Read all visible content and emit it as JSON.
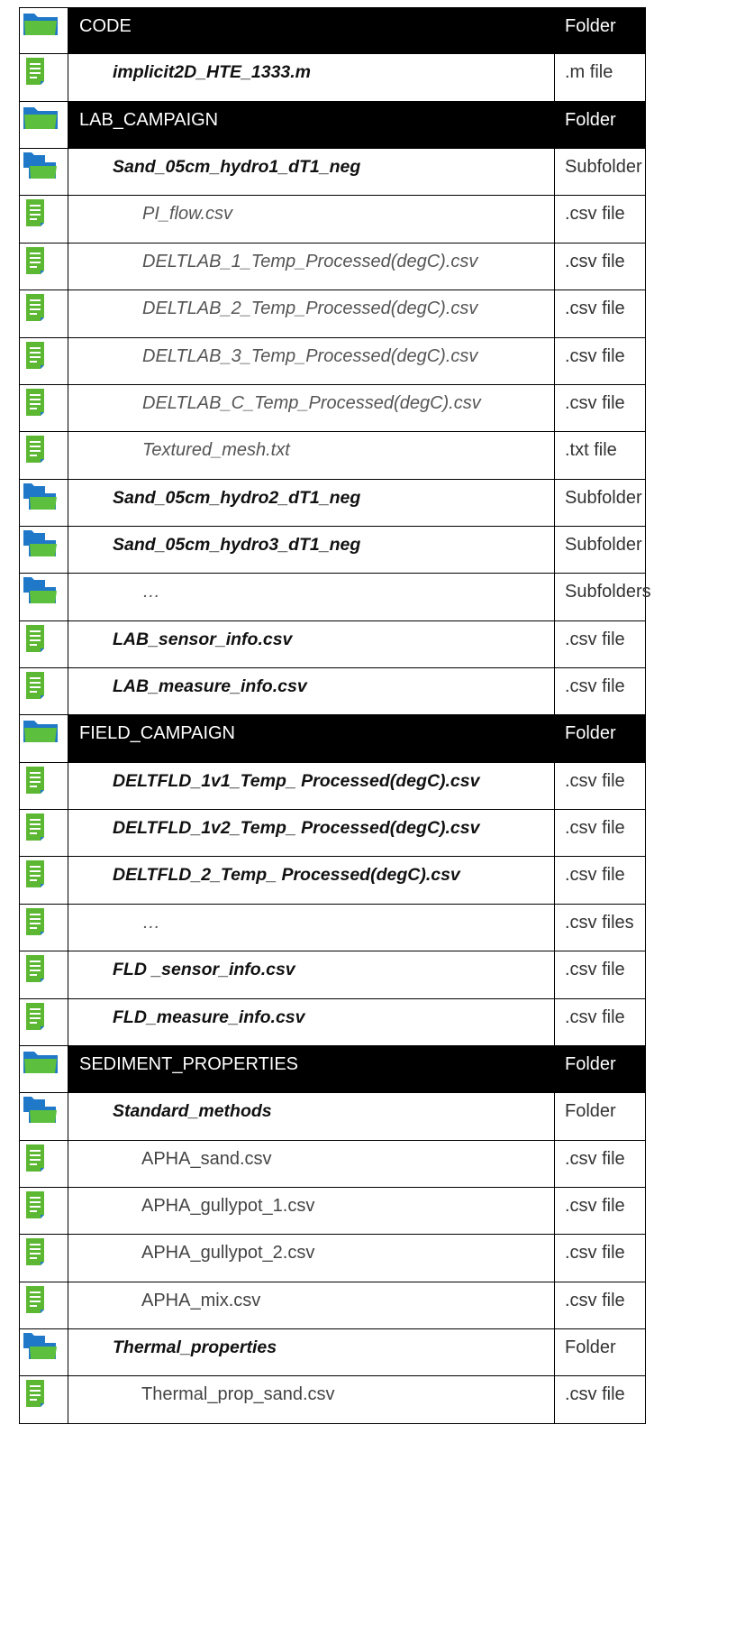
{
  "rows": [
    {
      "kind": "folder",
      "icon": "folder-icon",
      "name": "CODE",
      "type": "Folder"
    },
    {
      "kind": "file",
      "level": 1,
      "icon": "document-icon",
      "name": "implicit2D_HTE_1333.m",
      "type": ".m file"
    },
    {
      "kind": "folder",
      "icon": "folder-icon",
      "name": "LAB_CAMPAIGN",
      "type": "Folder"
    },
    {
      "kind": "subfolder",
      "level": 1,
      "icon": "subfolder-icon",
      "name": "Sand_05cm_hydro1_dT1_neg",
      "type": "Subfolder"
    },
    {
      "kind": "file",
      "level": 2,
      "icon": "document-icon",
      "name": "PI_flow.csv",
      "type": ".csv file"
    },
    {
      "kind": "file",
      "level": 2,
      "icon": "document-icon",
      "name": "DELTLAB_1_Temp_Processed(degC).csv",
      "type": ".csv file"
    },
    {
      "kind": "file",
      "level": 2,
      "icon": "document-icon",
      "name": "DELTLAB_2_Temp_Processed(degC).csv",
      "type": ".csv file"
    },
    {
      "kind": "file",
      "level": 2,
      "icon": "document-icon",
      "name": "DELTLAB_3_Temp_Processed(degC).csv",
      "type": ".csv file"
    },
    {
      "kind": "file",
      "level": 2,
      "icon": "document-icon",
      "name": "DELTLAB_C_Temp_Processed(degC).csv",
      "type": ".csv file"
    },
    {
      "kind": "file",
      "level": 2,
      "icon": "document-icon",
      "name": "Textured_mesh.txt",
      "type": ".txt file"
    },
    {
      "kind": "subfolder",
      "level": 1,
      "icon": "subfolder-icon",
      "name": "Sand_05cm_hydro2_dT1_neg",
      "type": "Subfolder"
    },
    {
      "kind": "subfolder",
      "level": 1,
      "icon": "subfolder-icon",
      "name": "Sand_05cm_hydro3_dT1_neg",
      "type": "Subfolder"
    },
    {
      "kind": "subfolder",
      "level": 2,
      "icon": "subfolder-icon",
      "name": "…",
      "type": "Subfolders"
    },
    {
      "kind": "file",
      "level": 1,
      "icon": "document-icon",
      "name": "LAB_sensor_info.csv",
      "type": ".csv file"
    },
    {
      "kind": "file",
      "level": 1,
      "icon": "document-icon",
      "name": "LAB_measure_info.csv",
      "type": ".csv file"
    },
    {
      "kind": "folder",
      "icon": "folder-icon",
      "name": "FIELD_CAMPAIGN",
      "type": "Folder"
    },
    {
      "kind": "file",
      "level": 1,
      "icon": "document-icon",
      "name": "DELTFLD_1v1_Temp_ Processed(degC).csv",
      "type": ".csv file"
    },
    {
      "kind": "file",
      "level": 1,
      "icon": "document-icon",
      "name": "DELTFLD_1v2_Temp_ Processed(degC).csv",
      "type": ".csv file"
    },
    {
      "kind": "file",
      "level": 1,
      "icon": "document-icon",
      "name": "DELTFLD_2_Temp_ Processed(degC).csv",
      "type": ".csv file"
    },
    {
      "kind": "file",
      "level": 2,
      "icon": "document-icon",
      "name": "…",
      "type": ".csv files"
    },
    {
      "kind": "file",
      "level": 1,
      "icon": "document-icon",
      "name": "FLD _sensor_info.csv",
      "type": ".csv file"
    },
    {
      "kind": "file",
      "level": 1,
      "icon": "document-icon",
      "name": "FLD_measure_info.csv",
      "type": ".csv file"
    },
    {
      "kind": "folder",
      "icon": "folder-icon",
      "name": "SEDIMENT_PROPERTIES",
      "type": "Folder"
    },
    {
      "kind": "subfolder",
      "level": 1,
      "icon": "subfolder-icon",
      "name": "Standard_methods",
      "type": "Folder"
    },
    {
      "kind": "file",
      "level": 3,
      "icon": "document-icon",
      "name": "APHA_sand.csv",
      "type": ".csv file"
    },
    {
      "kind": "file",
      "level": 3,
      "icon": "document-icon",
      "name": "APHA_gullypot_1.csv",
      "type": ".csv file"
    },
    {
      "kind": "file",
      "level": 3,
      "icon": "document-icon",
      "name": "APHA_gullypot_2.csv",
      "type": ".csv file"
    },
    {
      "kind": "file",
      "level": 3,
      "icon": "document-icon",
      "name": "APHA_mix.csv",
      "type": ".csv file"
    },
    {
      "kind": "subfolder",
      "level": 1,
      "icon": "subfolder-icon",
      "name": "Thermal_properties",
      "type": "Folder"
    },
    {
      "kind": "file",
      "level": 3,
      "icon": "document-icon",
      "name": "Thermal_prop_sand.csv",
      "type": ".csv file"
    }
  ],
  "colors": {
    "folder_blue": "#1f78c8",
    "folder_green": "#5cbf3d",
    "doc_green": "#5cb832",
    "header_bg": "#000000"
  }
}
